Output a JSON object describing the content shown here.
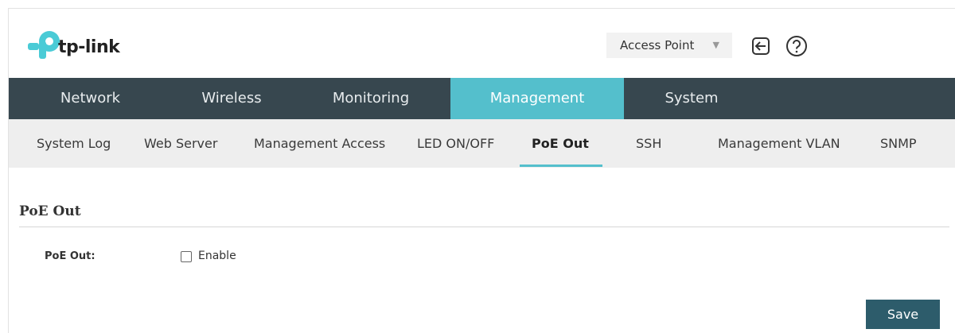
{
  "header": {
    "logo_text": "tp-link",
    "mode_select": {
      "value": "Access Point"
    },
    "logout_icon": "logout-icon",
    "help_icon": "help-icon"
  },
  "main_nav": {
    "tabs": [
      {
        "label": "Network",
        "active": false
      },
      {
        "label": "Wireless",
        "active": false
      },
      {
        "label": "Monitoring",
        "active": false
      },
      {
        "label": "Management",
        "active": true
      },
      {
        "label": "System",
        "active": false
      }
    ]
  },
  "sub_nav": {
    "items": [
      {
        "label": "System Log",
        "active": false
      },
      {
        "label": "Web Server",
        "active": false
      },
      {
        "label": "Management Access",
        "active": false
      },
      {
        "label": "LED ON/OFF",
        "active": false
      },
      {
        "label": "PoE Out",
        "active": true
      },
      {
        "label": "SSH",
        "active": false
      },
      {
        "label": "Management VLAN",
        "active": false
      },
      {
        "label": "SNMP",
        "active": false
      }
    ]
  },
  "content": {
    "section_title": "PoE Out",
    "poe_field": {
      "label": "PoE Out:",
      "checkbox_label": "Enable",
      "checked": false
    },
    "save_label": "Save"
  },
  "colors": {
    "nav_bg": "#37474f",
    "accent": "#54bfcc",
    "save_bg": "#2d5c6b",
    "logo_pink": "#4acbd6"
  }
}
